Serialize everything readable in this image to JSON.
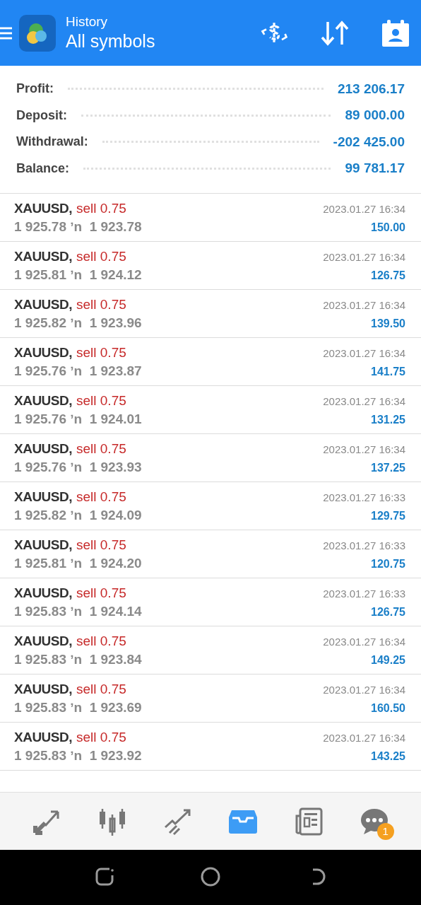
{
  "header": {
    "title": "History",
    "subtitle": "All symbols"
  },
  "summary": [
    {
      "label": "Profit:",
      "value": "213 206.17"
    },
    {
      "label": "Deposit:",
      "value": "89 000.00"
    },
    {
      "label": "Withdrawal:",
      "value": "-202 425.00"
    },
    {
      "label": "Balance:",
      "value": "99 781.17"
    }
  ],
  "deals": [
    {
      "symbol": "XAUUSD,",
      "side": "sell 0.75",
      "prices": "1 925.78 ʼn  1 923.78",
      "time": "2023.01.27 16:34",
      "profit": "150.00"
    },
    {
      "symbol": "XAUUSD,",
      "side": "sell 0.75",
      "prices": "1 925.81 ʼn  1 924.12",
      "time": "2023.01.27 16:34",
      "profit": "126.75"
    },
    {
      "symbol": "XAUUSD,",
      "side": "sell 0.75",
      "prices": "1 925.82 ʼn  1 923.96",
      "time": "2023.01.27 16:34",
      "profit": "139.50"
    },
    {
      "symbol": "XAUUSD,",
      "side": "sell 0.75",
      "prices": "1 925.76 ʼn  1 923.87",
      "time": "2023.01.27 16:34",
      "profit": "141.75"
    },
    {
      "symbol": "XAUUSD,",
      "side": "sell 0.75",
      "prices": "1 925.76 ʼn  1 924.01",
      "time": "2023.01.27 16:34",
      "profit": "131.25"
    },
    {
      "symbol": "XAUUSD,",
      "side": "sell 0.75",
      "prices": "1 925.76 ʼn  1 923.93",
      "time": "2023.01.27 16:34",
      "profit": "137.25"
    },
    {
      "symbol": "XAUUSD,",
      "side": "sell 0.75",
      "prices": "1 925.82 ʼn  1 924.09",
      "time": "2023.01.27 16:33",
      "profit": "129.75"
    },
    {
      "symbol": "XAUUSD,",
      "side": "sell 0.75",
      "prices": "1 925.81 ʼn  1 924.20",
      "time": "2023.01.27 16:33",
      "profit": "120.75"
    },
    {
      "symbol": "XAUUSD,",
      "side": "sell 0.75",
      "prices": "1 925.83 ʼn  1 924.14",
      "time": "2023.01.27 16:33",
      "profit": "126.75"
    },
    {
      "symbol": "XAUUSD,",
      "side": "sell 0.75",
      "prices": "1 925.83 ʼn  1 923.84",
      "time": "2023.01.27 16:34",
      "profit": "149.25"
    },
    {
      "symbol": "XAUUSD,",
      "side": "sell 0.75",
      "prices": "1 925.83 ʼn  1 923.69",
      "time": "2023.01.27 16:34",
      "profit": "160.50"
    },
    {
      "symbol": "XAUUSD,",
      "side": "sell 0.75",
      "prices": "1 925.83 ʼn  1 923.92",
      "time": "2023.01.27 16:34",
      "profit": "143.25"
    }
  ],
  "tabs": [
    {
      "kind": "trade",
      "selected": false
    },
    {
      "kind": "chart",
      "selected": false
    },
    {
      "kind": "trend",
      "selected": false
    },
    {
      "kind": "history",
      "selected": true
    },
    {
      "kind": "news",
      "selected": false
    },
    {
      "kind": "chat",
      "selected": false,
      "badge": "1"
    }
  ]
}
